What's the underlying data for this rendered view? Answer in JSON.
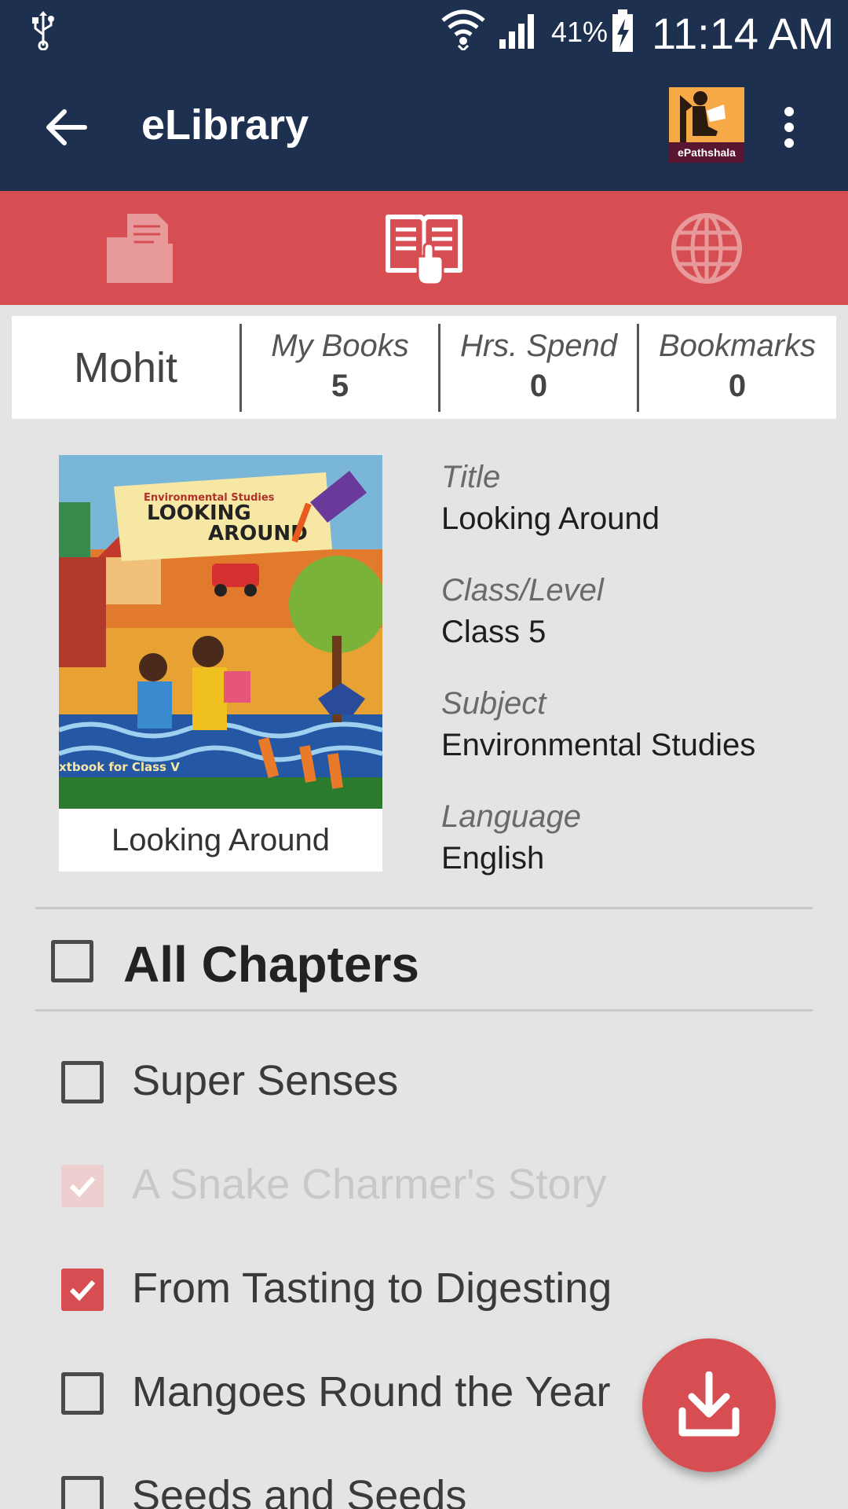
{
  "status_bar": {
    "battery_percent": "41%",
    "time": "11:14 AM"
  },
  "app_bar": {
    "title": "eLibrary",
    "logo_text": "ePathshala"
  },
  "tabs": [
    {
      "icon": "documents-folder-icon",
      "active": false
    },
    {
      "icon": "book-touch-icon",
      "active": true
    },
    {
      "icon": "globe-icon",
      "active": false
    }
  ],
  "stats": {
    "user_name": "Mohit",
    "my_books_label": "My Books",
    "my_books_value": "5",
    "hrs_spend_label": "Hrs. Spend",
    "hrs_spend_value": "0",
    "bookmarks_label": "Bookmarks",
    "bookmarks_value": "0"
  },
  "book": {
    "cover_caption": "Looking Around",
    "cover_subject": "Environmental Studies",
    "cover_title_line1": "LOOKING",
    "cover_title_line2": "AROUND",
    "cover_footer": "xtbook for Class V",
    "title_label": "Title",
    "title_value": "Looking Around",
    "class_label": "Class/Level",
    "class_value": "Class 5",
    "subject_label": "Subject",
    "subject_value": "Environmental Studies",
    "language_label": "Language",
    "language_value": "English"
  },
  "chapters": {
    "all_label": "All Chapters",
    "all_checked": false,
    "items": [
      {
        "label": "Super Senses",
        "checked": false,
        "disabled": false
      },
      {
        "label": "A Snake Charmer's Story",
        "checked": true,
        "disabled": true
      },
      {
        "label": "From Tasting to Digesting",
        "checked": true,
        "disabled": false
      },
      {
        "label": "Mangoes Round the Year",
        "checked": false,
        "disabled": false
      },
      {
        "label": "Seeds and Seeds",
        "checked": false,
        "disabled": false
      }
    ]
  },
  "fab": {
    "icon": "download-icon"
  },
  "colors": {
    "app_bar": "#1e3050",
    "accent": "#d64d52",
    "background": "#e4e4e4"
  }
}
